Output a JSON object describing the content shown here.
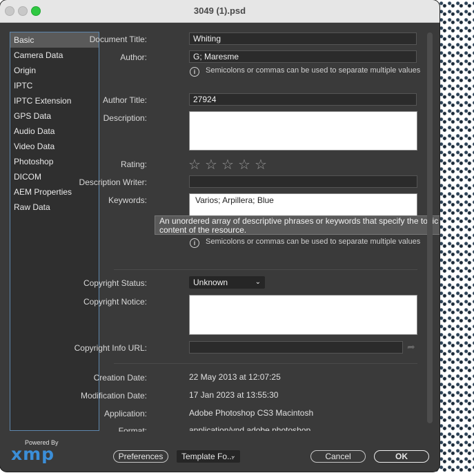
{
  "window": {
    "title": "3049 (1).psd"
  },
  "sidebar": {
    "items": [
      {
        "label": "Basic"
      },
      {
        "label": "Camera Data"
      },
      {
        "label": "Origin"
      },
      {
        "label": "IPTC"
      },
      {
        "label": "IPTC Extension"
      },
      {
        "label": "GPS Data"
      },
      {
        "label": "Audio Data"
      },
      {
        "label": "Video Data"
      },
      {
        "label": "Photoshop"
      },
      {
        "label": "DICOM"
      },
      {
        "label": "AEM Properties"
      },
      {
        "label": "Raw Data"
      }
    ],
    "selected": "Basic"
  },
  "branding": {
    "powered_by": "Powered By",
    "logo_text": "xmp"
  },
  "form": {
    "document_title": {
      "label": "Document Title:",
      "value": "Whiting"
    },
    "author": {
      "label": "Author:",
      "value": "G; Maresme"
    },
    "hint_separator": "Semicolons or commas can be used to separate multiple values",
    "author_title": {
      "label": "Author Title:",
      "value": "27924"
    },
    "description": {
      "label": "Description:",
      "value": ""
    },
    "rating": {
      "label": "Rating:",
      "stars_total": 5,
      "stars_filled": 0
    },
    "description_writer": {
      "label": "Description Writer:",
      "value": ""
    },
    "keywords": {
      "label": "Keywords:",
      "value": "Varios; Arpillera; Blue"
    },
    "keywords_tooltip": "An unordered array of descriptive phrases or keywords that specify the topic of the content of the resource.",
    "copyright_status": {
      "label": "Copyright Status:",
      "value": "Unknown"
    },
    "copyright_notice": {
      "label": "Copyright Notice:",
      "value": ""
    },
    "copyright_info_url": {
      "label": "Copyright Info URL:",
      "value": ""
    },
    "creation_date": {
      "label": "Creation Date:",
      "value": "22 May 2013 at 12:07:25"
    },
    "modification_date": {
      "label": "Modification Date:",
      "value": "17 Jan 2023 at 13:55:30"
    },
    "application": {
      "label": "Application:",
      "value": "Adobe Photoshop CS3 Macintosh"
    },
    "format": {
      "label": "Format:",
      "value": "application/vnd.adobe.photoshop"
    }
  },
  "footer": {
    "preferences": "Preferences",
    "template": "Template Fo...",
    "cancel": "Cancel",
    "ok": "OK"
  },
  "icons": {
    "info": "info-circle-icon",
    "star": "star-outline-icon",
    "chevron": "chevron-down-icon",
    "go": "arrow-go-icon"
  }
}
